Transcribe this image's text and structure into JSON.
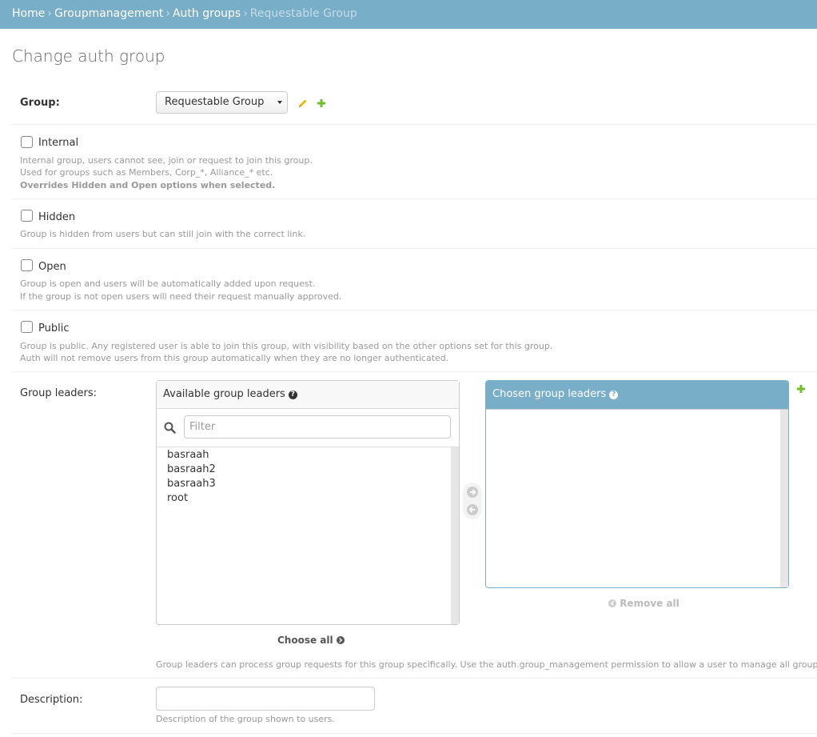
{
  "breadcrumbs": {
    "home": "Home",
    "app": "Groupmanagement",
    "model": "Auth groups",
    "current": "Requestable Group",
    "separator": "›"
  },
  "page_title": "Change auth group",
  "group_field": {
    "label": "Group:",
    "selected": "Requestable Group"
  },
  "internal": {
    "label": "Internal",
    "checked": false,
    "help_1": "Internal group, users cannot see, join or request to join this group.",
    "help_2": "Used for groups such as Members, Corp_*, Alliance_* etc.",
    "help_3": "Overrides Hidden and Open options when selected."
  },
  "hidden": {
    "label": "Hidden",
    "checked": false,
    "help_1": "Group is hidden from users but can still join with the correct link."
  },
  "open": {
    "label": "Open",
    "checked": false,
    "help_1": "Group is open and users will be automatically added upon request.",
    "help_2": "If the group is not open users will need their request manually approved."
  },
  "public": {
    "label": "Public",
    "checked": false,
    "help_1": "Group is public. Any registered user is able to join this group, with visibility based on the other options set for this group.",
    "help_2": "Auth will not remove users from this group automatically when they are no longer authenticated."
  },
  "group_leaders": {
    "label": "Group leaders:",
    "available_title": "Available group leaders",
    "chosen_title": "Chosen group leaders",
    "filter_placeholder": "Filter",
    "available": [
      "basraah",
      "basraah2",
      "basraah3",
      "root"
    ],
    "chosen": [],
    "choose_all": "Choose all",
    "remove_all": "Remove all",
    "help": "Group leaders can process group requests for this group specifically. Use the auth.group_management permission to allow a user to manage all groups. Hold down \"Control\", or \"Command\" on a Mac, to select more than one."
  },
  "description": {
    "label": "Description:",
    "value": "",
    "help": "Description of the group shown to users."
  },
  "colors": {
    "header": "#79aec8",
    "edit_icon": "#efb80b",
    "add_icon": "#70bf2b"
  }
}
